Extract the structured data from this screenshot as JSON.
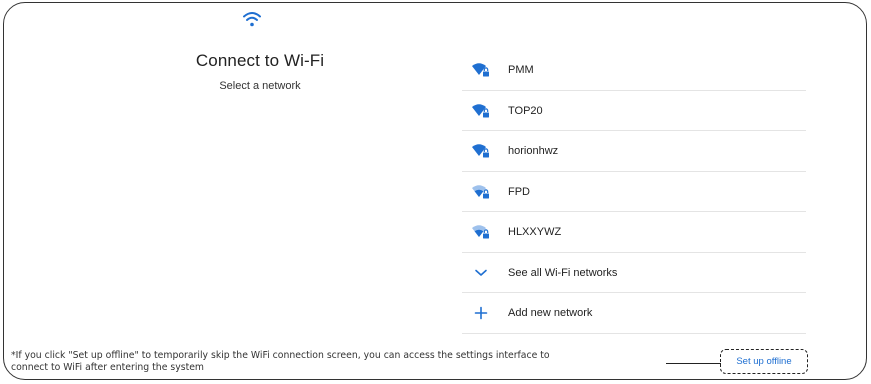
{
  "header": {
    "title": "Connect to Wi-Fi",
    "subtitle": "Select a network"
  },
  "networks": [
    {
      "name": "PMM",
      "icon": "wifi-locked-icon"
    },
    {
      "name": "TOP20",
      "icon": "wifi-locked-icon"
    },
    {
      "name": "horionhwz",
      "icon": "wifi-locked-icon"
    },
    {
      "name": "FPD",
      "icon": "wifi-weak-locked-icon"
    },
    {
      "name": "HLXXYWZ",
      "icon": "wifi-weak-locked-icon"
    }
  ],
  "actions": {
    "see_all": "See all Wi-Fi networks",
    "add_network": "Add new network"
  },
  "footer": {
    "note_line1": "*If you click \"Set up offline\" to temporarily skip the WiFi connection screen, you can access the settings interface to",
    "note_line2": "connect to WiFi after entering the system",
    "offline_button": "Set up offline"
  },
  "colors": {
    "accent": "#1f6fd1",
    "wifi_icon": "#1f6fd1",
    "wifi_icon_faded": "#9ec1ec"
  }
}
